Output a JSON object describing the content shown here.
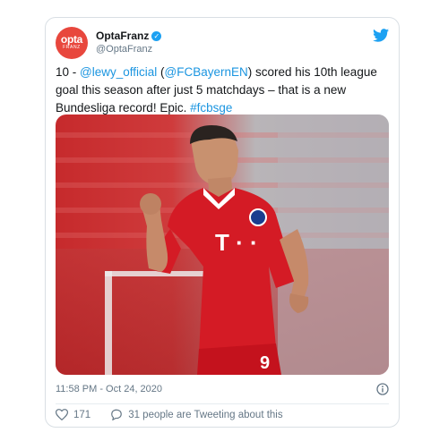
{
  "author": {
    "display_name": "OptaFranz",
    "handle": "@OptaFranz",
    "avatar_text_top": "opta",
    "avatar_text_bottom": "FRANZ"
  },
  "tweet": {
    "parts": [
      {
        "text": "10 - ",
        "link": false
      },
      {
        "text": "@lewy_official",
        "link": true
      },
      {
        "text": " (",
        "link": false
      },
      {
        "text": "@FCBayernEN",
        "link": true
      },
      {
        "text": ") scored his 10th league goal this season after just 5 matchdays – that is a new Bundesliga record! Epic. ",
        "link": false
      },
      {
        "text": "#fcbsge",
        "link": true
      }
    ]
  },
  "photo": {
    "jersey_number": "9",
    "jersey_sponsor": "T · ·"
  },
  "timestamp": "11:58 PM - Oct 24, 2020",
  "actions": {
    "like_count": "171",
    "conversation": "31 people are Tweeting about this"
  },
  "colors": {
    "link": "#1b95e0",
    "verified": "#1da1f2",
    "avatar": "#e8473d",
    "jersey": "#d41b25"
  },
  "icons": {
    "brand": "twitter-bird-icon",
    "verified": "verified-badge-icon",
    "info": "info-icon",
    "like": "heart-icon",
    "reply": "speech-bubble-icon"
  }
}
